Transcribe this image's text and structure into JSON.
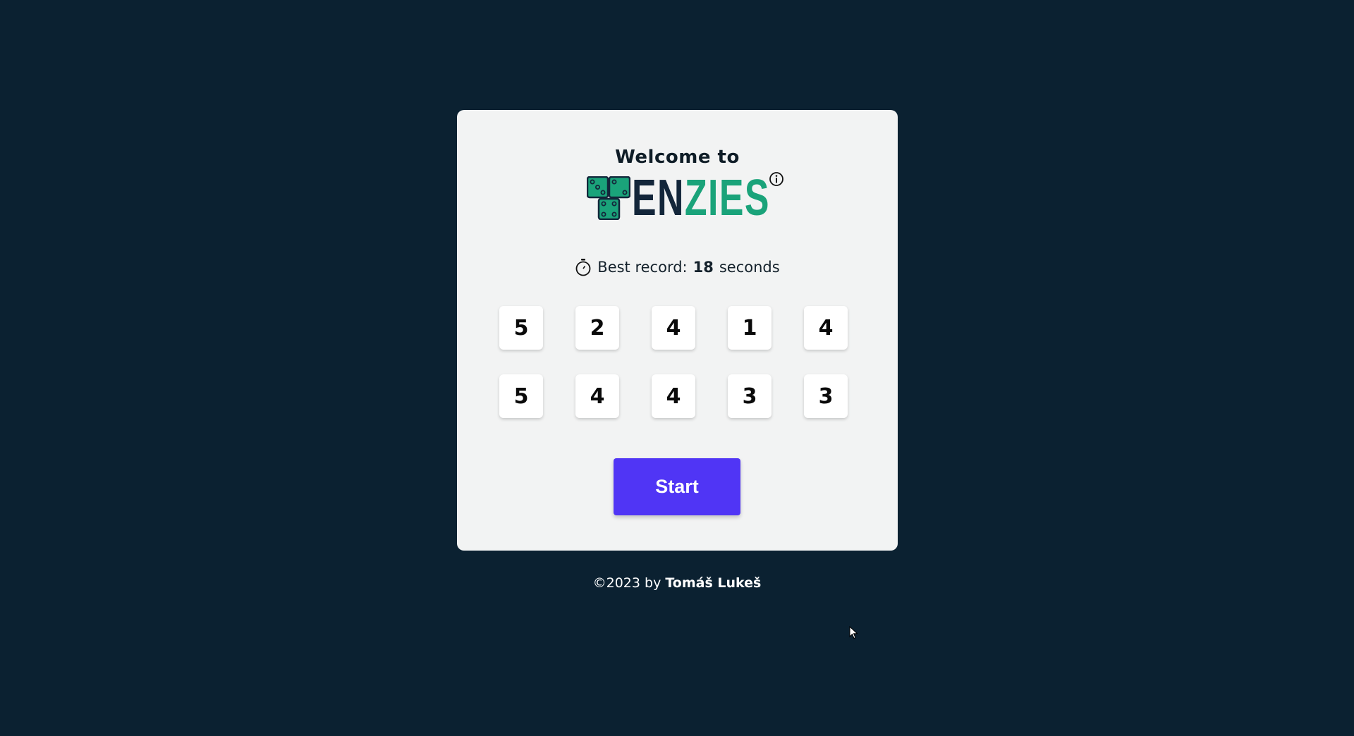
{
  "card": {
    "welcome": "Welcome to",
    "logo": {
      "text_dark": "EN",
      "text_green": "ZIES",
      "icon": "dice-t-icon"
    },
    "info_icon": "info-icon"
  },
  "record": {
    "prefix": "Best record:",
    "value": "18",
    "suffix": "seconds",
    "icon": "stopwatch-icon"
  },
  "dice": [
    "5",
    "2",
    "4",
    "1",
    "4",
    "5",
    "4",
    "4",
    "3",
    "3"
  ],
  "start_label": "Start",
  "footer": {
    "prefix": "©2023 by",
    "author": "Tomáš Lukeš"
  },
  "colors": {
    "background": "#0b2131",
    "card": "#f2f3f3",
    "accent": "#5035f5",
    "logo_green": "#1aa37a",
    "logo_dark": "#13263a"
  }
}
